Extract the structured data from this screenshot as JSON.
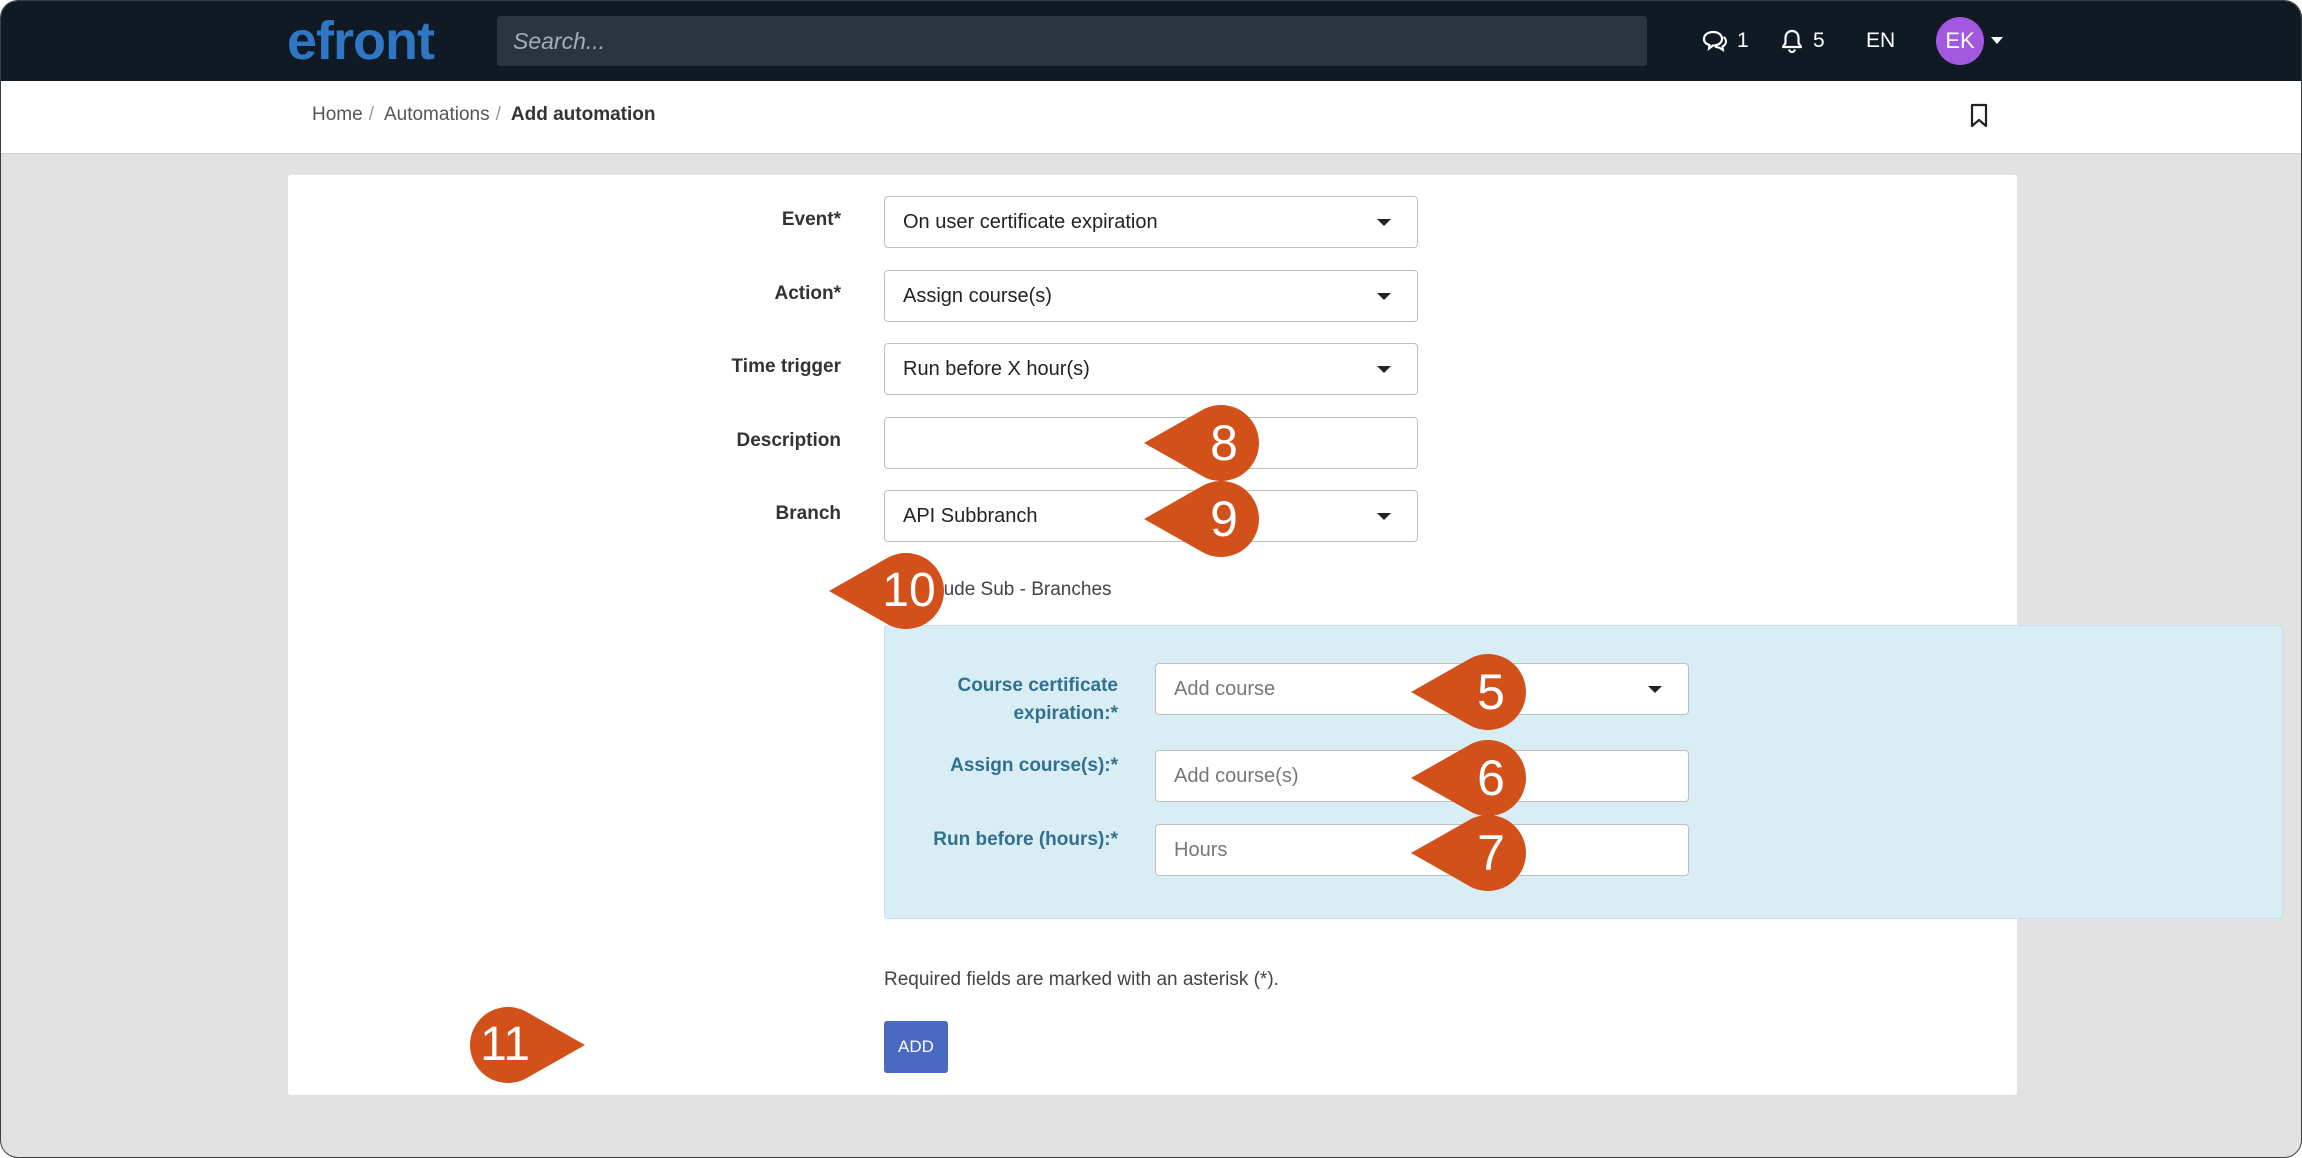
{
  "topbar": {
    "logo_text": "efront",
    "search_placeholder": "Search...",
    "messages_count": "1",
    "notifications_count": "5",
    "language": "EN",
    "avatar_initials": "EK"
  },
  "breadcrumb": {
    "items": [
      "Home",
      "Automations"
    ],
    "current": "Add automation",
    "separator": "/"
  },
  "form": {
    "event_label": "Event*",
    "event_value": "On user certificate expiration",
    "action_label": "Action*",
    "action_value": "Assign course(s)",
    "time_trigger_label": "Time trigger",
    "time_trigger_value": "Run before X hour(s)",
    "description_label": "Description",
    "description_value": "",
    "branch_label": "Branch",
    "branch_value": "API Subbranch",
    "include_sub_branches_label": "Include Sub - Branches",
    "include_sub_branches_checked": false
  },
  "panel": {
    "course_cert_label_line1": "Course certificate",
    "course_cert_label_line2": "expiration:*",
    "course_cert_placeholder": "Add course",
    "assign_courses_label": "Assign course(s):*",
    "assign_courses_placeholder": "Add course(s)",
    "run_before_label": "Run before (hours):*",
    "run_before_placeholder": "Hours"
  },
  "footer": {
    "required_note": "Required fields are marked with an asterisk (*).",
    "add_button": "ADD"
  },
  "callouts": {
    "description": "8",
    "branch": "9",
    "include_sub": "10",
    "course_cert": "5",
    "assign_courses": "6",
    "run_before": "7",
    "add": "11"
  },
  "colors": {
    "topbar_bg": "#0f1a24",
    "logo_blue": "#2f77c5",
    "logo_orange": "#f28a1b",
    "avatar_bg": "#a259e0",
    "panel_bg": "#d9edf5",
    "panel_label": "#31708f",
    "button_bg": "#4a6ac2",
    "callout_bg": "#d2501a"
  }
}
